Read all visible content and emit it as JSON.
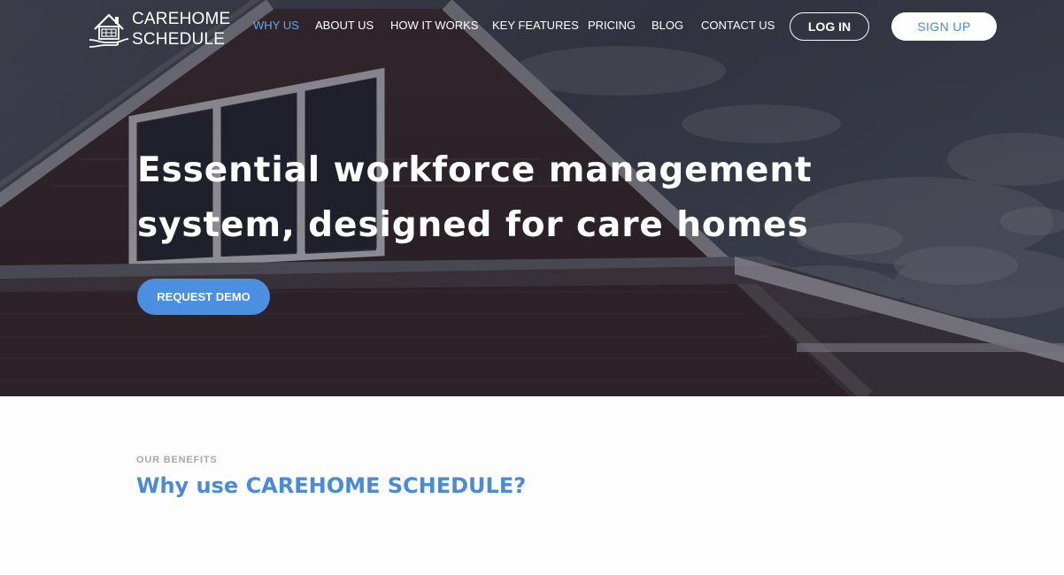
{
  "brand": {
    "line1": "CAREHOME",
    "line2": "SCHEDULE"
  },
  "nav": {
    "items": [
      {
        "label": "WHY US",
        "active": true
      },
      {
        "label": "ABOUT US",
        "active": false
      },
      {
        "label": "HOW IT WORKS",
        "active": false
      },
      {
        "label": "KEY FEATURES",
        "active": false
      },
      {
        "label": "PRICING",
        "active": false
      },
      {
        "label": "BLOG",
        "active": false
      },
      {
        "label": "CONTACT US",
        "active": false
      }
    ],
    "login_label": "LOG IN",
    "signup_label": "SIGN UP"
  },
  "hero": {
    "title": "Essential workforce management system, designed for care homes",
    "cta_label": "REQUEST DEMO"
  },
  "benefits": {
    "eyebrow": "OUR BENEFITS",
    "title": "Why use CAREHOME SCHEDULE?"
  },
  "colors": {
    "accent": "#4a8fe0",
    "nav_active": "#6ea3ea",
    "heading_blue": "#4a8ad8",
    "hero_overlay": "#2c2a35",
    "eyebrow_gray": "#a8a8a8",
    "page_bg": "#fdfdfd"
  },
  "icons": {
    "logo": "house-in-hand-icon"
  }
}
